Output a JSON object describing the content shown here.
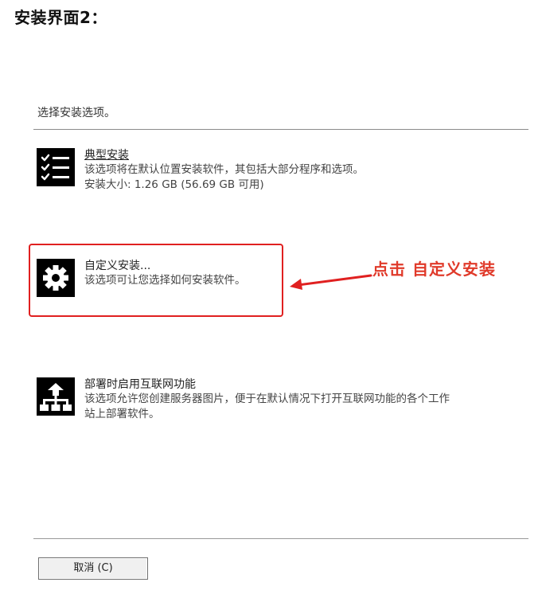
{
  "page": {
    "heading": "安装界面2："
  },
  "dialog": {
    "prompt": "选择安装选项。",
    "options": [
      {
        "title": "典型安装",
        "desc_lines": [
          "该选项将在默认位置安装软件，其包括大部分程序和选项。",
          "安装大小: 1.26 GB (56.69 GB 可用)"
        ]
      },
      {
        "title": "自定义安装...",
        "desc_lines": [
          "该选项可让您选择如何安装软件。"
        ]
      },
      {
        "title": "部署时启用互联网功能",
        "desc_lines": [
          "该选项允许您创建服务器图片，便于在默认情况下打开互联网功能的各个工作",
          "站上部署软件。"
        ]
      }
    ],
    "cancel_label": "取消 (C)"
  },
  "annotation": {
    "text": "点击 自定义安装",
    "color": "#e03a2a"
  },
  "icons": [
    "checklist-icon",
    "gear-icon",
    "network-icon"
  ]
}
